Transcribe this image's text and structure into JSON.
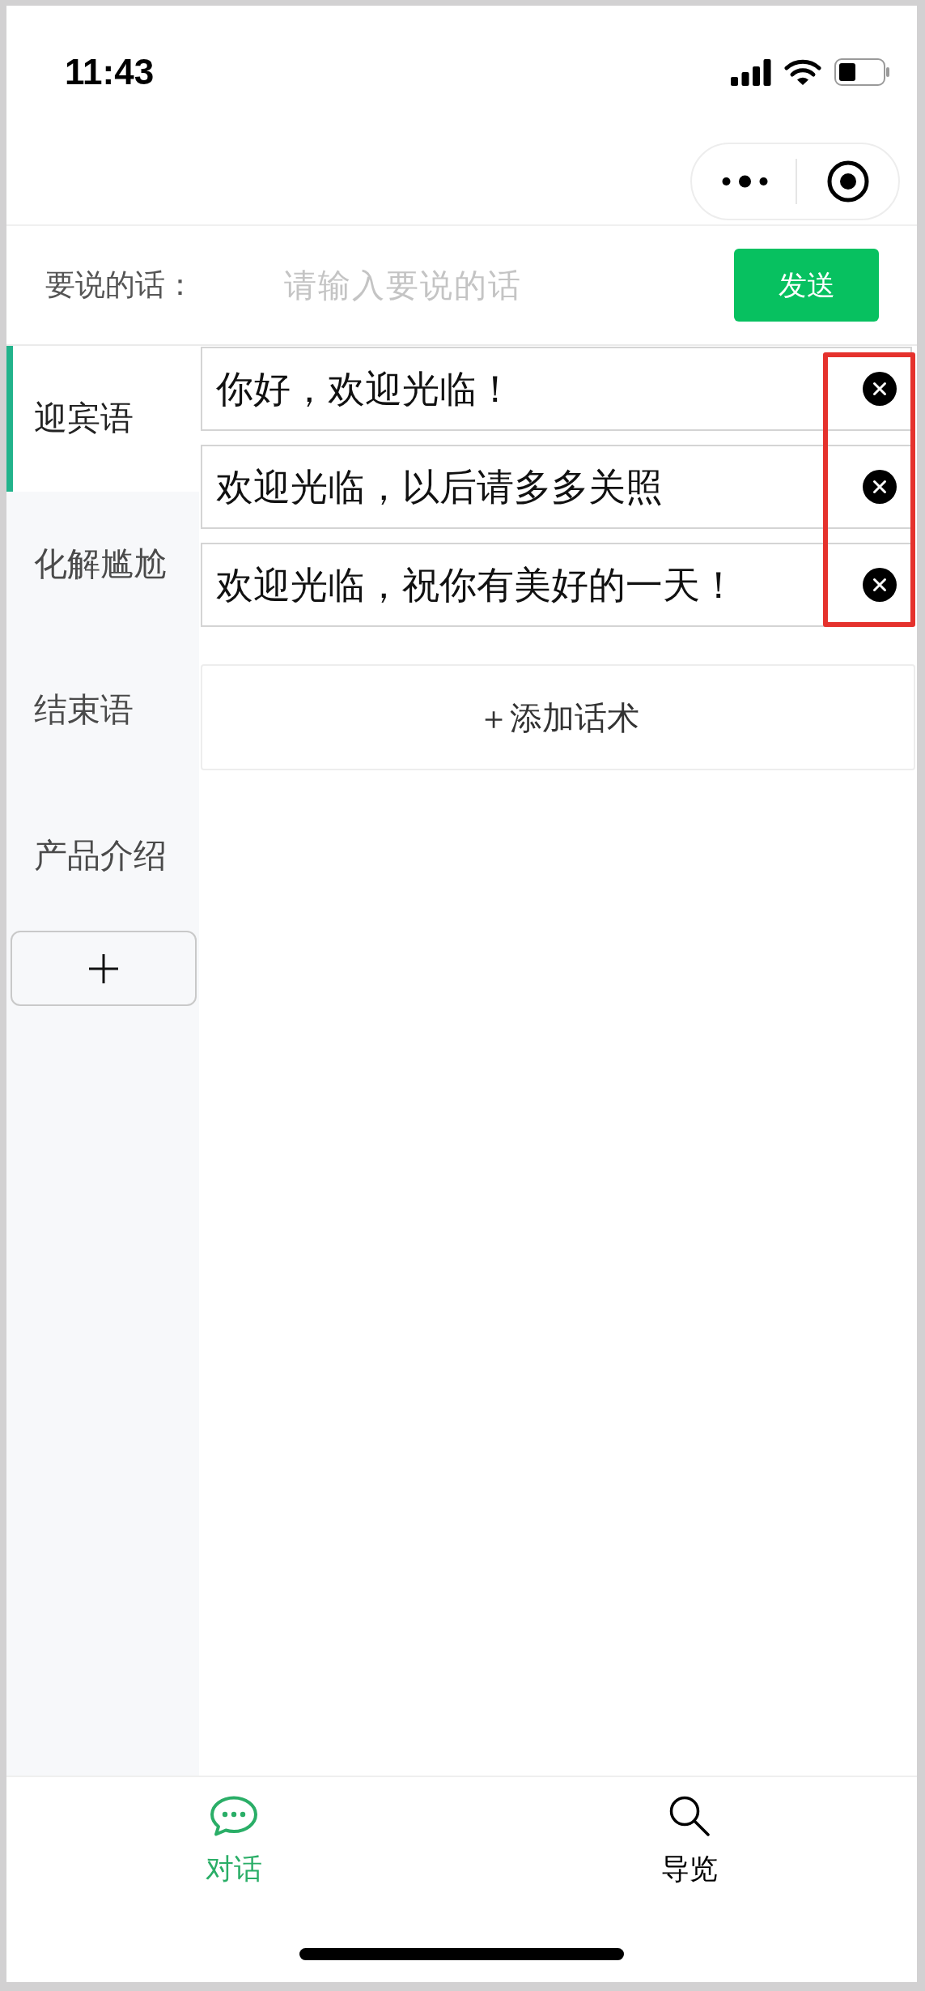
{
  "status_bar": {
    "time": "11:43"
  },
  "composer": {
    "label": "要说的话：",
    "placeholder": "请输入要说的话",
    "send_button": "发送"
  },
  "categories": [
    {
      "label": "迎宾语",
      "selected": true
    },
    {
      "label": "化解尴尬",
      "selected": false
    },
    {
      "label": "结束语",
      "selected": false
    },
    {
      "label": "产品介绍",
      "selected": false
    }
  ],
  "phrases": {
    "delete_buttons_highlighted": true,
    "items": [
      {
        "text": "你好，欢迎光临！"
      },
      {
        "text": "欢迎光临，以后请多多关照"
      },
      {
        "text": "欢迎光临，祝你有美好的一天！"
      }
    ]
  },
  "add_phrase_button": "＋添加话术",
  "tab_bar": [
    {
      "label": "对话",
      "selected": true
    },
    {
      "label": "导览",
      "selected": false
    }
  ]
}
